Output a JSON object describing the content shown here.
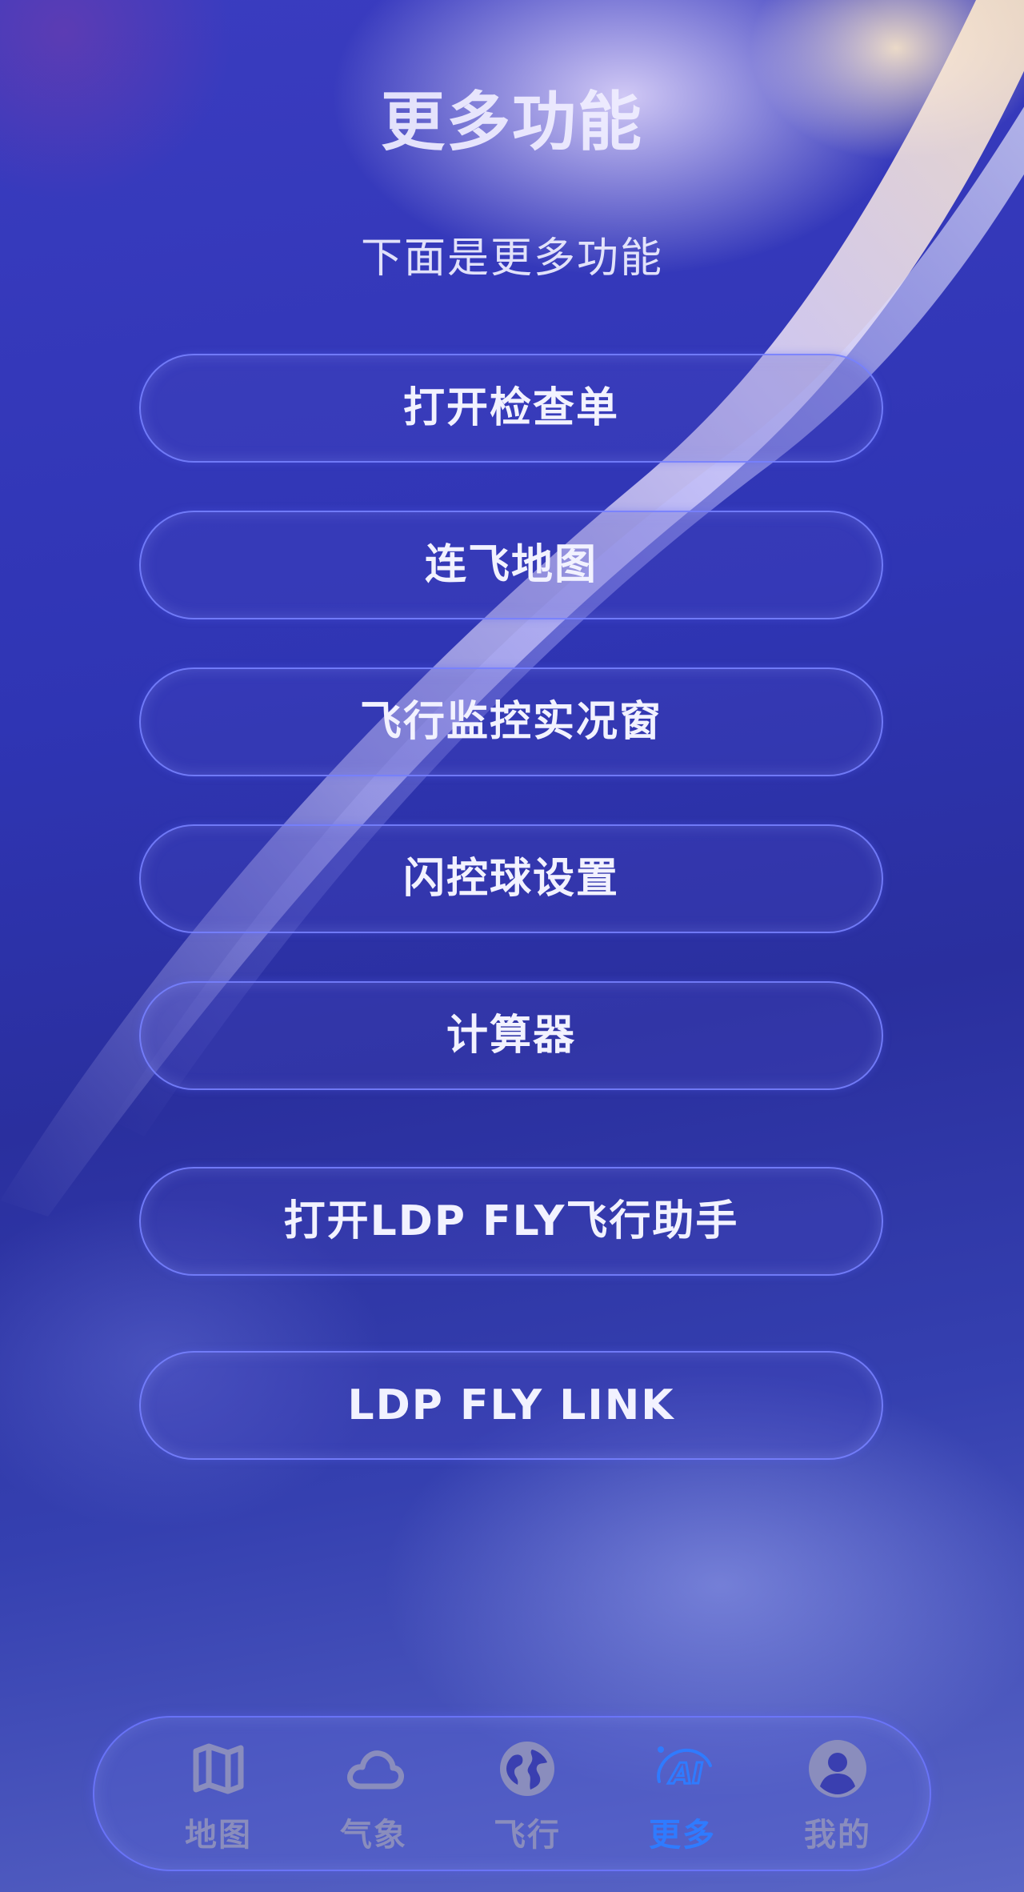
{
  "page": {
    "title": "更多功能",
    "subtitle": "下面是更多功能"
  },
  "menu": {
    "items": [
      {
        "label": "打开检查单"
      },
      {
        "label": "连飞地图"
      },
      {
        "label": "飞行监控实况窗"
      },
      {
        "label": "闪控球设置"
      },
      {
        "label": "计算器"
      },
      {
        "label": "打开LDP FLY飞行助手"
      },
      {
        "label": "LDP FLY LINK"
      }
    ]
  },
  "tabbar": {
    "tabs": [
      {
        "label": "地图",
        "icon": "map-icon"
      },
      {
        "label": "气象",
        "icon": "cloud-icon"
      },
      {
        "label": "飞行",
        "icon": "globe-icon"
      },
      {
        "label": "更多",
        "icon": "ai-icon",
        "active": true
      },
      {
        "label": "我的",
        "icon": "user-icon"
      }
    ]
  },
  "colors": {
    "accent": "#2f7bff",
    "inactive_tab": "#8a8dbd",
    "button_border": "#7882ff",
    "text": "#f2f2ff"
  }
}
